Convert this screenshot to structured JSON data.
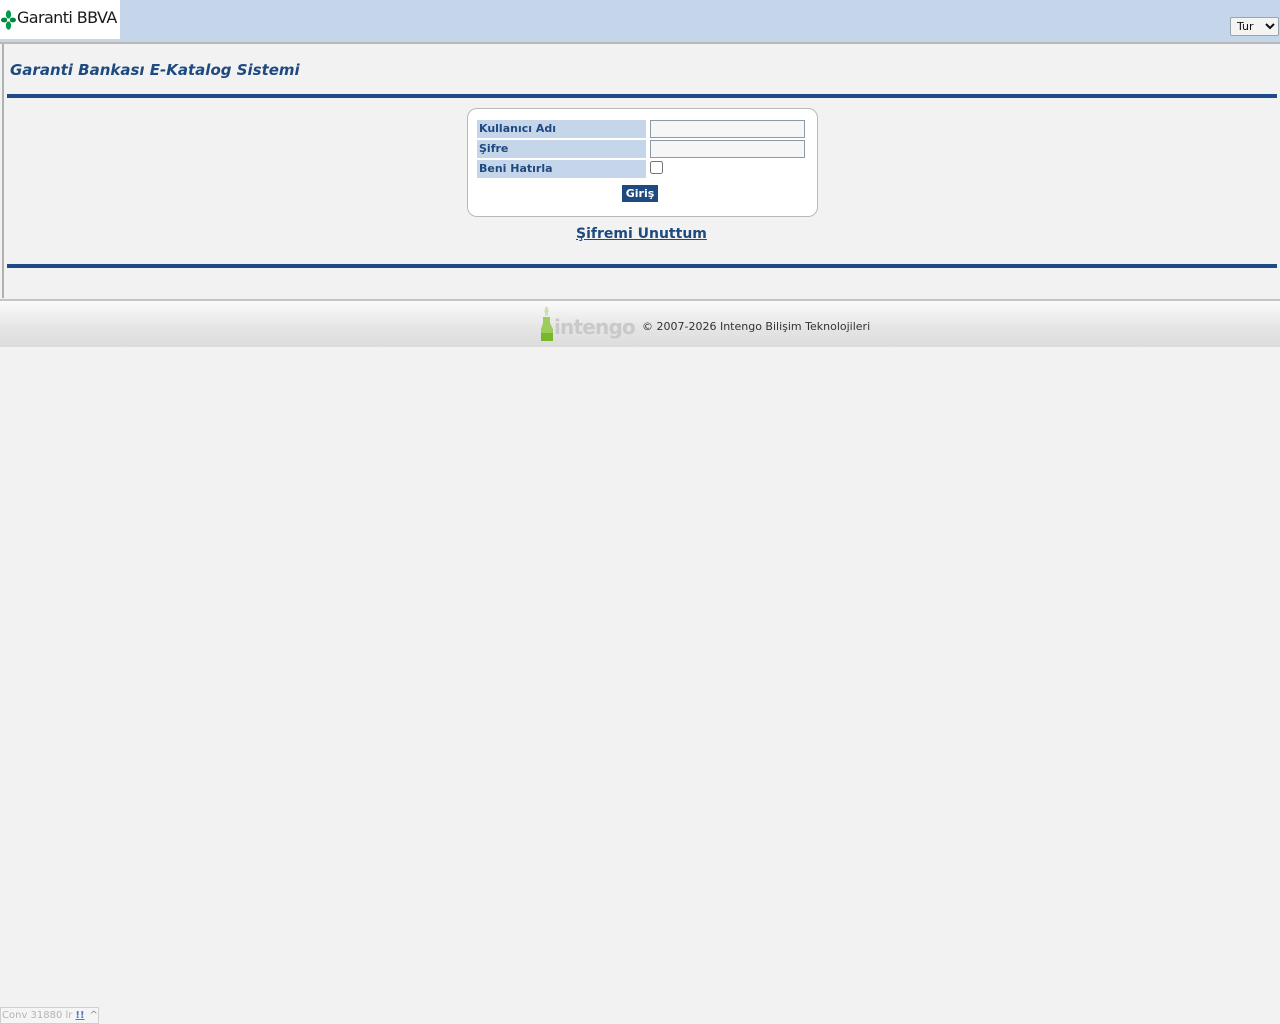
{
  "header": {
    "brand": "Garanti BBVA",
    "language": {
      "selected": "Tur",
      "options": [
        "Tur"
      ]
    }
  },
  "main": {
    "title": "Garanti Bankası E-Katalog Sistemi"
  },
  "login": {
    "username_label": "Kullanıcı Adı",
    "username_value": "",
    "password_label": "Şifre",
    "password_value": "",
    "remember_label": "Beni Hatırla",
    "remember_checked": false,
    "submit_label": "Giriş",
    "forgot_label": "Şifremi Unuttum"
  },
  "footer": {
    "logo": "intengo",
    "copyright": "© 2007-2026 Intengo Bilişim Teknolojileri"
  },
  "debug_bar": {
    "text": "Conv 31880 lr",
    "link": "!!",
    "toggle": "^"
  },
  "colors": {
    "accent": "#1e4a7f",
    "header_bg": "#c5d5ea",
    "rule": "#1f4a88",
    "page_bg": "#f2f2f2",
    "brand_green": "#009a49"
  }
}
